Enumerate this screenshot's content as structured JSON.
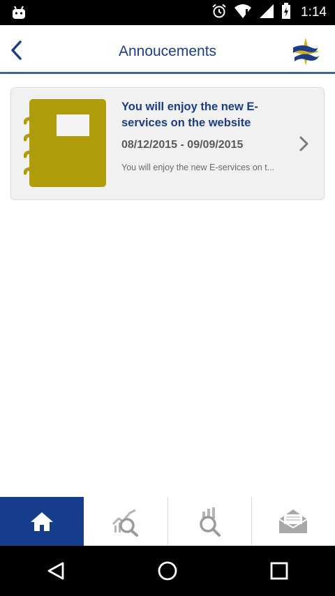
{
  "status_bar": {
    "time": "1:14",
    "icons": [
      "android-debug-icon",
      "alarm-icon",
      "wifi-icon",
      "signal-icon",
      "battery-charging-icon"
    ]
  },
  "header": {
    "title": "Annoucements",
    "back_icon": "chevron-left-icon",
    "logo_icon": "brand-logo"
  },
  "announcements": [
    {
      "title": "You will enjoy the new E-services on the website",
      "date_range": "08/12/2015 - 09/09/2015",
      "description": "You will enjoy the new E-services on t...",
      "icon": "notebook-icon"
    }
  ],
  "bottom_nav": {
    "tabs": [
      {
        "id": "home",
        "icon": "home-icon",
        "active": true
      },
      {
        "id": "market-search",
        "icon": "chart-search-icon",
        "active": false
      },
      {
        "id": "stock-search",
        "icon": "stock-search-icon",
        "active": false
      },
      {
        "id": "messages",
        "icon": "envelope-icon",
        "active": false
      }
    ]
  },
  "system_nav": {
    "buttons": [
      "back-triangle-icon",
      "home-circle-icon",
      "recents-square-icon"
    ]
  },
  "colors": {
    "brand_blue": "#1d3c86",
    "header_rule": "#3b63a3",
    "active_tab": "#163d8c",
    "notebook_gold": "#b09c0a",
    "card_bg": "#f1f1f1"
  }
}
